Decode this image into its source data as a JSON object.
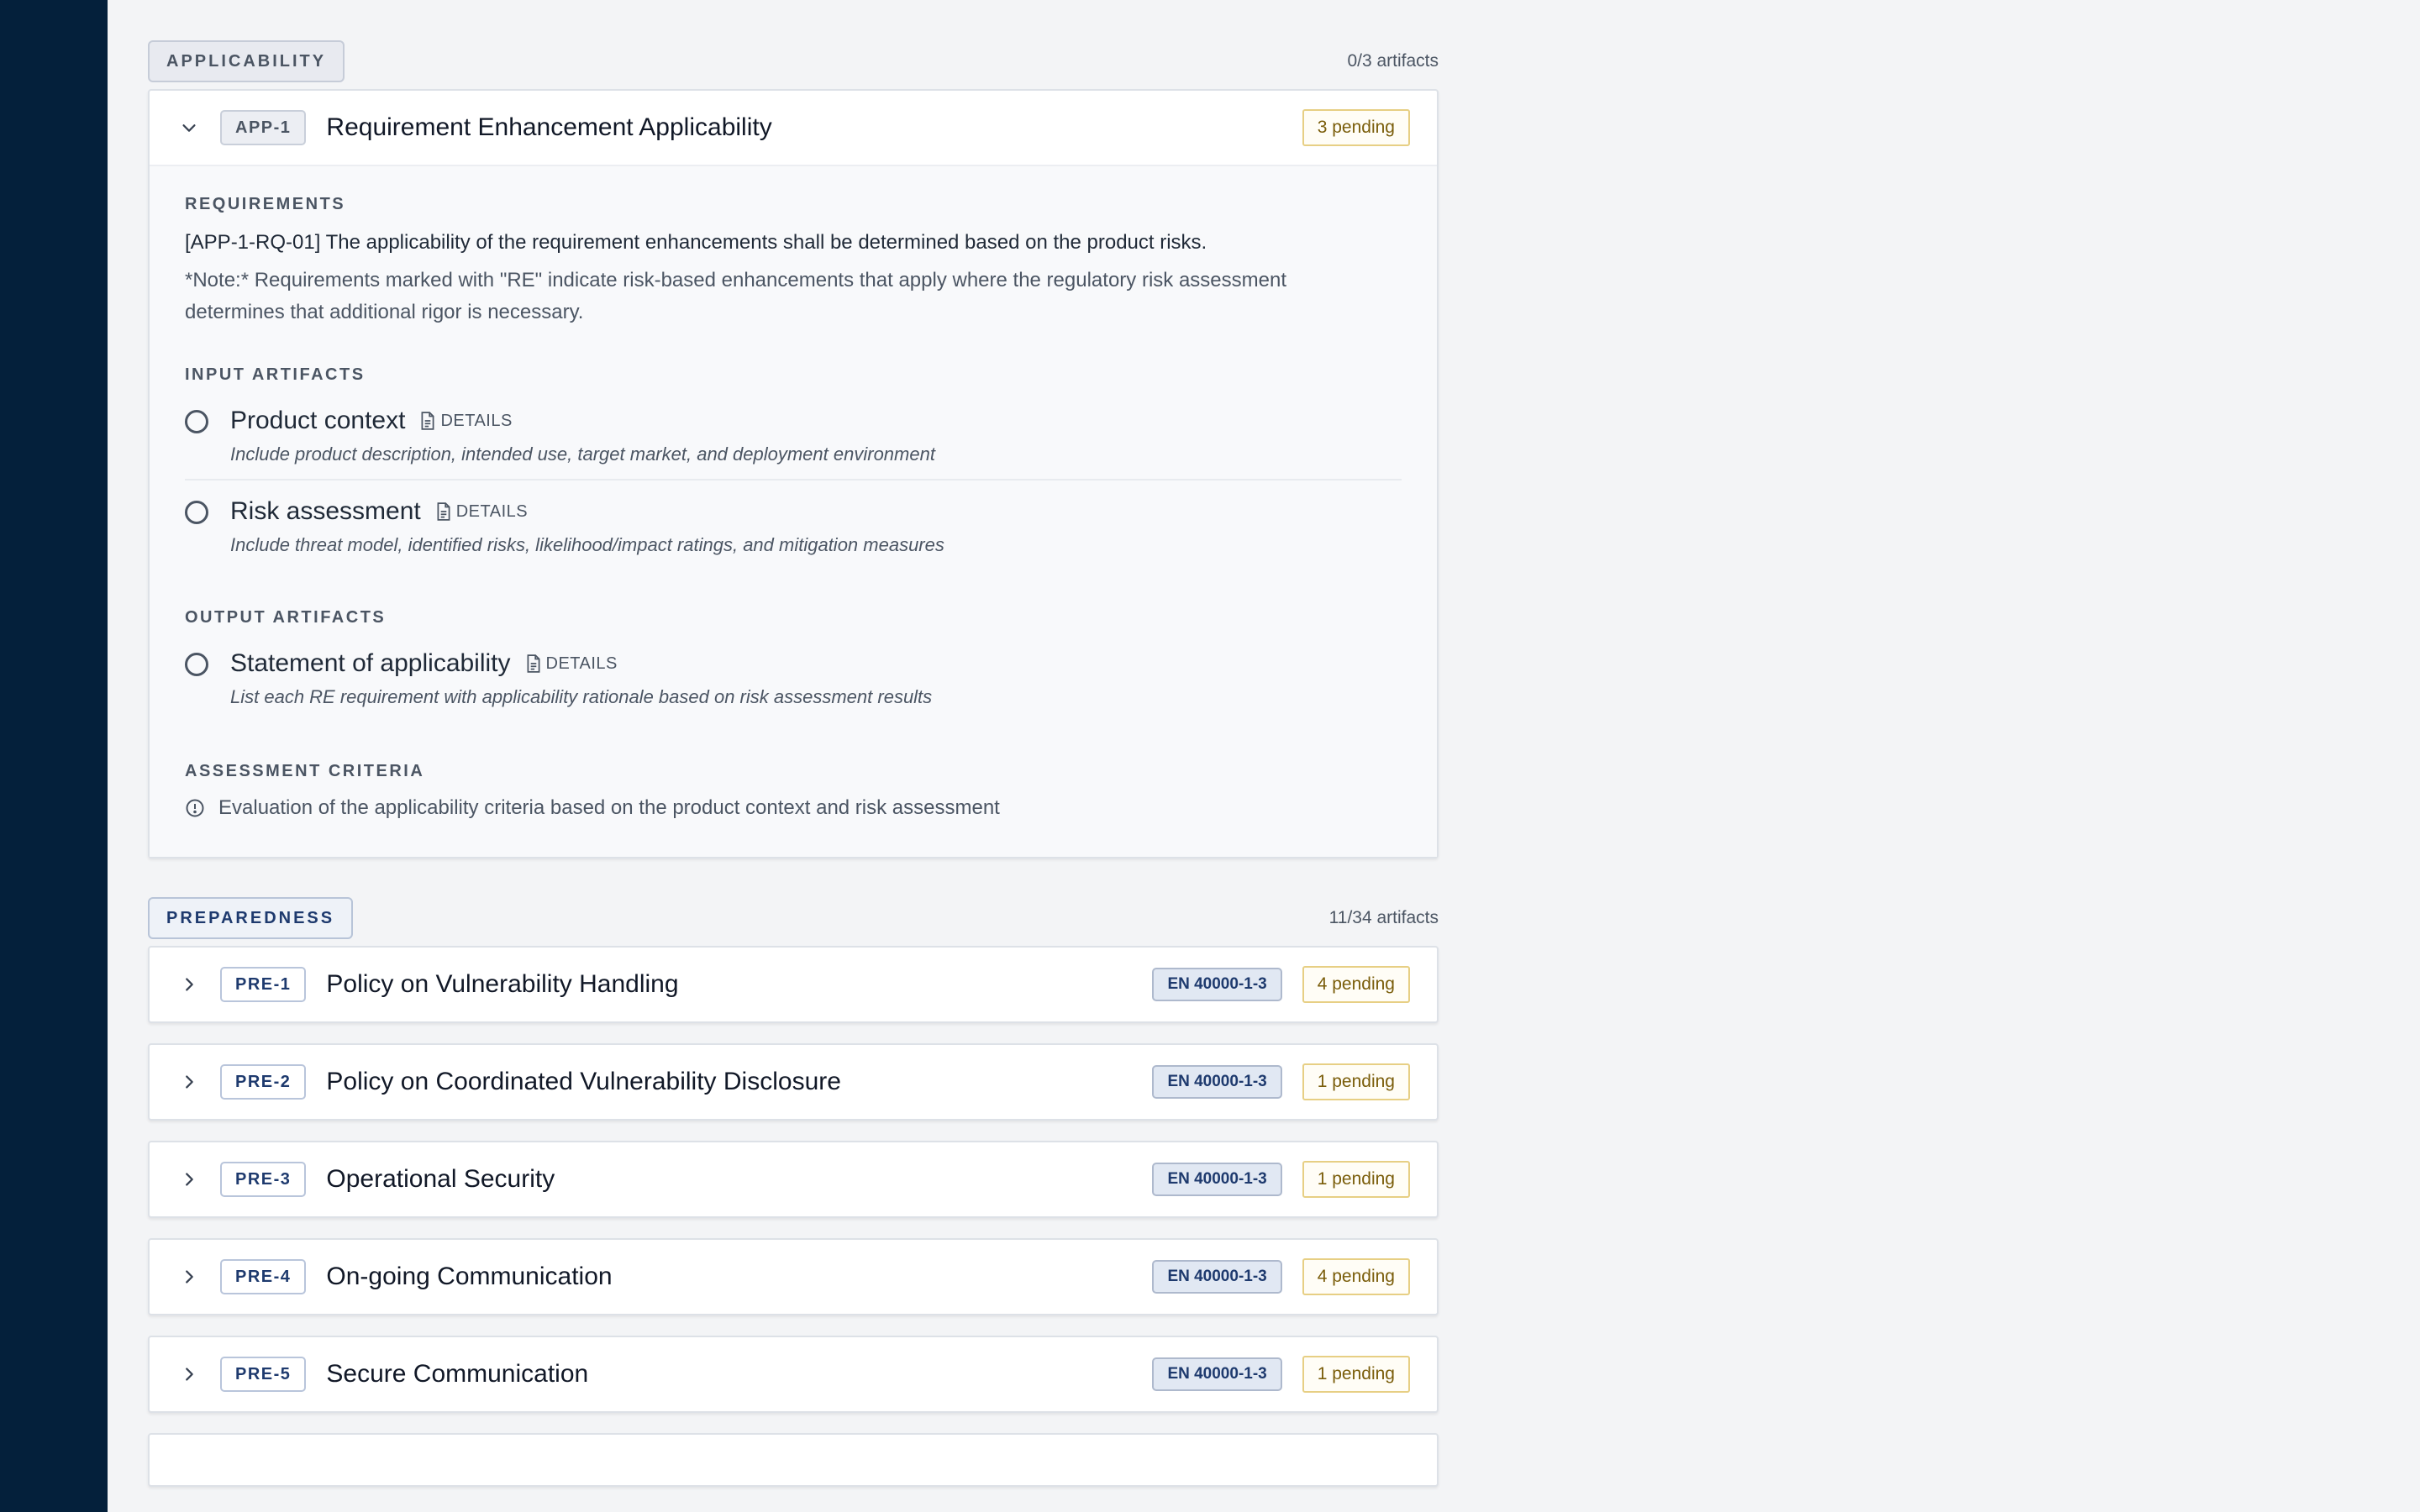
{
  "applicability": {
    "label": "APPLICABILITY",
    "count": "0/3 artifacts",
    "card": {
      "code": "APP-1",
      "title": "Requirement Enhancement Applicability",
      "pending": "3 pending",
      "requirements_heading": "REQUIREMENTS",
      "requirement": "[APP-1-RQ-01] The applicability of the requirement enhancements shall be determined based on the product risks.",
      "note": "*Note:* Requirements marked with \"RE\" indicate risk-based enhancements that apply where the regulatory risk assessment determines that additional rigor is necessary.",
      "input_heading": "INPUT ARTIFACTS",
      "inputs": [
        {
          "name": "Product context",
          "details": "DETAILS",
          "desc": "Include product description, intended use, target market, and deployment environment"
        },
        {
          "name": "Risk assessment",
          "details": "DETAILS",
          "desc": "Include threat model, identified risks, likelihood/impact ratings, and mitigation measures"
        }
      ],
      "output_heading": "OUTPUT ARTIFACTS",
      "outputs": [
        {
          "name": "Statement of applicability",
          "details": "DETAILS",
          "desc": "List each RE requirement with applicability rationale based on risk assessment results"
        }
      ],
      "criteria_heading": "ASSESSMENT CRITERIA",
      "criteria": "Evaluation of the applicability criteria based on the product context and risk assessment"
    }
  },
  "preparedness": {
    "label": "PREPAREDNESS",
    "count": "11/34 artifacts",
    "items": [
      {
        "code": "PRE-1",
        "title": "Policy on Vulnerability Handling",
        "standard": "EN 40000-1-3",
        "pending": "4 pending"
      },
      {
        "code": "PRE-2",
        "title": "Policy on Coordinated Vulnerability Disclosure",
        "standard": "EN 40000-1-3",
        "pending": "1 pending"
      },
      {
        "code": "PRE-3",
        "title": "Operational Security",
        "standard": "EN 40000-1-3",
        "pending": "1 pending"
      },
      {
        "code": "PRE-4",
        "title": "On-going Communication",
        "standard": "EN 40000-1-3",
        "pending": "4 pending"
      },
      {
        "code": "PRE-5",
        "title": "Secure Communication",
        "standard": "EN 40000-1-3",
        "pending": "1 pending"
      }
    ]
  },
  "icons": {
    "chevron_down": "chevron-down-icon",
    "chevron_right": "chevron-right-icon",
    "document": "document-icon",
    "radio": "radio-unchecked-icon",
    "info": "info-circle-icon"
  },
  "colors": {
    "sidebar": "#04203b",
    "background": "#f3f4f6",
    "pending_border": "#e7cf84",
    "pending_text": "#7a5d0a",
    "standard_badge": "#e1e8f3"
  }
}
